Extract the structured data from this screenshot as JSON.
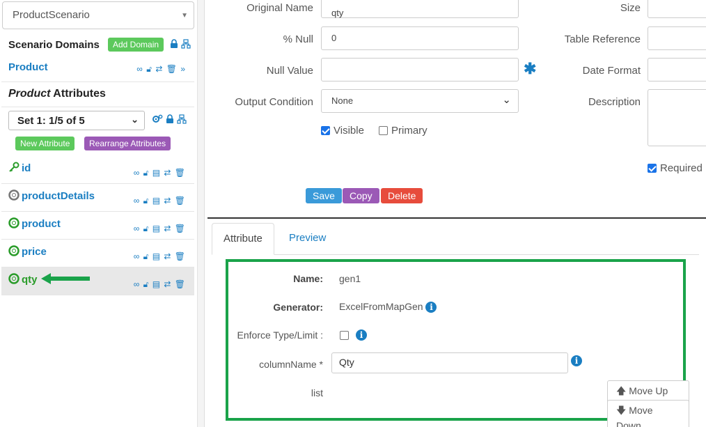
{
  "sidebar": {
    "scenario_select": "ProductScenario",
    "domains_title": "Scenario Domains",
    "add_domain_label": "Add Domain",
    "domain_name": "Product",
    "attributes_title_italic": "Product",
    "attributes_title_rest": " Attributes",
    "set_select": "Set 1: 1/5 of 5",
    "new_attribute_label": "New Attribute",
    "rearrange_label": "Rearrange Attributes",
    "attributes": [
      {
        "name": "id",
        "icon": "key-icon"
      },
      {
        "name": "productDetails",
        "icon": "lifebuoy-gray-icon"
      },
      {
        "name": "product",
        "icon": "lifebuoy-green-icon"
      },
      {
        "name": "price",
        "icon": "lifebuoy-green-icon"
      },
      {
        "name": "qty",
        "icon": "lifebuoy-green-icon",
        "selected": true
      }
    ]
  },
  "form": {
    "original_name_label": "Original Name",
    "original_name_value": "qty",
    "pct_null_label": "% Null",
    "pct_null_value": "0",
    "null_value_label": "Null Value",
    "null_value_value": "",
    "output_condition_label": "Output Condition",
    "output_condition_value": "None",
    "visible_label": "Visible",
    "primary_label": "Primary",
    "size_label": "Size",
    "table_reference_label": "Table Reference",
    "date_format_label": "Date Format",
    "description_label": "Description",
    "required_label": "Required",
    "save_label": "Save",
    "copy_label": "Copy",
    "delete_label": "Delete"
  },
  "tabs": {
    "attribute": "Attribute",
    "preview": "Preview"
  },
  "generator": {
    "name_label": "Name:",
    "name_value": "gen1",
    "generator_label": "Generator:",
    "generator_value": "ExcelFromMapGen",
    "enforce_label": "Enforce Type/Limit :",
    "column_name_label": "columnName *",
    "column_name_value": "Qty",
    "list_label": "list",
    "move_up_label": "Move Up",
    "move_down_label": "Move Down"
  },
  "colors": {
    "accent_blue": "#1a7ec2",
    "green": "#5cc95c",
    "purple": "#9b59b6",
    "save": "#3a9ad9",
    "delete": "#e74c3c",
    "highlight_border": "#1aa34a"
  }
}
